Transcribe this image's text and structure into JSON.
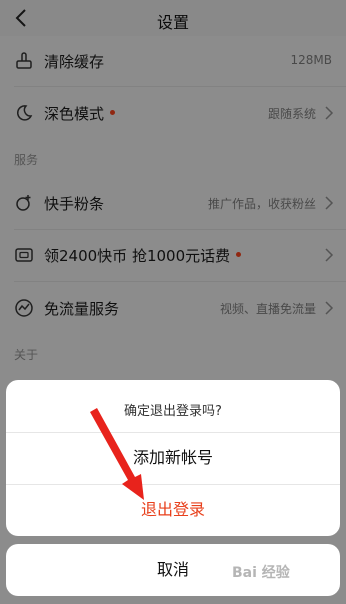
{
  "header": {
    "title": "设置"
  },
  "rows": [
    {
      "label": "清除缓存",
      "value": "128MB",
      "icon": "broom-icon",
      "dot": false
    },
    {
      "label": "深色模式",
      "value": "跟随系统",
      "icon": "moon-icon",
      "dot": true
    },
    {
      "label": "快手粉条",
      "value": "推广作品，收获粉丝",
      "icon": "boost-icon",
      "dot": false
    },
    {
      "label": "领2400快币 抢1000元话费",
      "value": "",
      "icon": "wallet-icon",
      "dot": true
    },
    {
      "label": "免流量服务",
      "value": "视频、直播免流量",
      "icon": "data-free-icon",
      "dot": false
    }
  ],
  "sections": {
    "service": "服务",
    "about": "关于"
  },
  "dialog": {
    "prompt": "确定退出登录吗?",
    "add_account": "添加新帐号",
    "logout": "退出登录",
    "cancel": "取消"
  },
  "colors": {
    "logout_red": "#e8401c",
    "dot_red": "#e8401c"
  },
  "watermark": "Bai 经验"
}
